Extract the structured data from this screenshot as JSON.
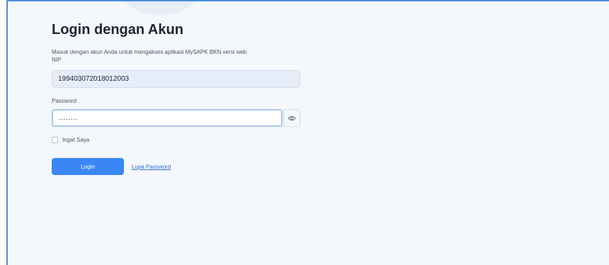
{
  "login": {
    "title": "Login dengan Akun",
    "subtitle": "Masuk dengan akun Anda untuk mengakses aplikasi MySAPK BKN versi web",
    "nip_label": "NIP",
    "nip_value": "199403072018012003",
    "password_label": "Password",
    "password_value": "........",
    "remember_label": "Ingat Saya",
    "login_button": "Login",
    "forgot_password": "Lupa Password"
  },
  "colors": {
    "accent": "#3b86f5",
    "link": "#2f6fd6",
    "frame_border": "#4a90d9",
    "background": "#f4f7fc"
  },
  "icons": {
    "password_toggle": "eye-icon"
  }
}
